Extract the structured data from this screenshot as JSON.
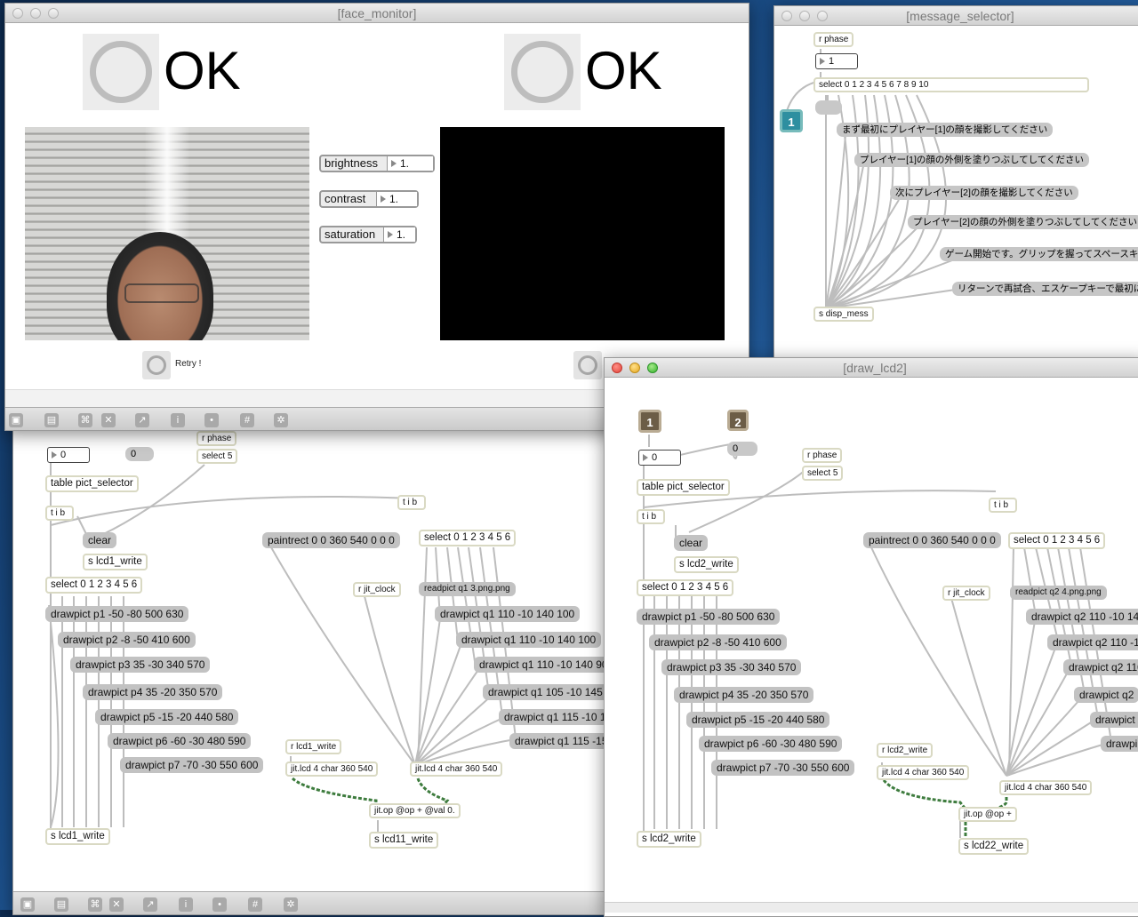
{
  "windows": {
    "face_monitor": {
      "title": "[face_monitor]",
      "status_left": "OK",
      "status_right": "OK",
      "brightness_label": "brightness",
      "brightness_value": "1.",
      "contrast_label": "contrast",
      "contrast_value": "1.",
      "saturation_label": "saturation",
      "saturation_value": "1.",
      "retry_label": "Retry !"
    },
    "message_selector": {
      "title": "[message_selector]",
      "r_phase": "r phase",
      "number": "1",
      "select": "select 0 1 2 3 4 5 6 7 8 9 10",
      "inlet": "1",
      "messages": [
        "まず最初にプレイヤー[1]の顔を撮影してください",
        "プレイヤー[1]の顔の外側を塗りつぶしてしてください",
        "次にプレイヤー[2]の顔を撮影してください",
        "プレイヤー[2]の顔の外側を塗りつぶしてしてください",
        "ゲーム開始です。グリップを握ってスペースキー",
        "リターンで再試合、エスケープキーで最初に"
      ],
      "send": "s disp_mess"
    },
    "draw_lcd1": {
      "number_left": "0",
      "toggle": "0",
      "r_phase": "r phase",
      "select5": "select 5",
      "table": "table pict_selector",
      "tib1": "t i b",
      "tib2": "t i b",
      "clear": "clear",
      "send_write": "s lcd1_write",
      "paintrect": "paintrect 0 0 360 540 0 0 0",
      "select_top": "select 0 1 2 3 4 5 6",
      "select_left": "select 0 1 2 3 4 5 6",
      "r_jit_clock": "r jit_clock",
      "readpict": "readpict q1 3.png.png",
      "drawpicts_left": [
        "drawpict p1 -50 -80 500 630",
        "drawpict p2 -8 -50 410 600",
        "drawpict p3 35 -30 340 570",
        "drawpict p4 35 -20 350 570",
        "drawpict p5 -15 -20 440 580",
        "drawpict p6 -60 -30 480 590",
        "drawpict p7 -70 -30 550 600"
      ],
      "drawpicts_right": [
        "drawpict q1 110 -10 140 100",
        "drawpict q1 110 -10 140 100",
        "drawpict q1 110 -10 140 90",
        "drawpict q1 105 -10 145",
        "drawpict q1 115 -10 1",
        "drawpict q1 115 -15"
      ],
      "r_write": "r lcd1_write",
      "jitlcd_a": "jit.lcd 4 char 360 540",
      "jitlcd_b": "jit.lcd 4 char 360 540",
      "jitop": "jit.op @op + @val 0.",
      "s_lcd11": "s lcd11_write",
      "s_lcd1_bottom": "s lcd1_write"
    },
    "draw_lcd2": {
      "title": "[draw_lcd2]",
      "inlet1": "1",
      "inlet2": "2",
      "number_left": "0",
      "toggle": "0",
      "r_phase": "r phase",
      "select5": "select 5",
      "table": "table pict_selector",
      "tib1": "t i b",
      "tib2": "t i b",
      "clear": "clear",
      "send_write": "s lcd2_write",
      "paintrect": "paintrect 0 0 360 540 0 0 0",
      "select_top": "select 0 1 2 3 4 5 6",
      "select_left": "select 0 1 2 3 4 5 6",
      "r_jit_clock": "r jit_clock",
      "readpict": "readpict q2 4.png.png",
      "drawpicts_left": [
        "drawpict p1 -50 -80 500 630",
        "drawpict p2 -8 -50 410 600",
        "drawpict p3 35 -30 340 570",
        "drawpict p4 35 -20 350 570",
        "drawpict p5 -15 -20 440 580",
        "drawpict p6 -60 -30 480 590",
        "drawpict p7 -70 -30 550 600"
      ],
      "drawpicts_right": [
        "drawpict q2 110 -10 140",
        "drawpict q2 110 -1",
        "drawpict q2 110",
        "drawpict q2",
        "drawpict q",
        "drawpi"
      ],
      "r_write": "r lcd2_write",
      "jitlcd_a": "jit.lcd 4 char 360 540",
      "jitlcd_b": "jit.lcd 4 char 360 540",
      "jitop": "jit.op @op +",
      "s_lcd22": "s lcd22_write",
      "s_lcd2_bottom": "s lcd2_write"
    }
  }
}
